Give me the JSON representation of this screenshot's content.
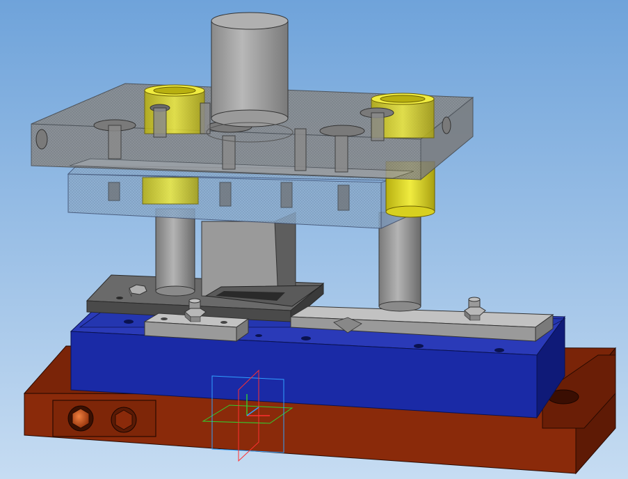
{
  "viewport": {
    "background_top": "#6fa3da",
    "background_bottom": "#c6dcf2"
  },
  "colors": {
    "base_plate": "#8a2a0a",
    "base_plate_dark": "#5a1a05",
    "base_plate_side": "#6e2008",
    "die_block": "#1a2aa6",
    "die_block_top": "#2a3ab8",
    "die_block_side": "#0f1a78",
    "guide_pillar": "#9a9a9a",
    "guide_pillar_shade": "#6e6e6e",
    "punch_holder_transparent": "#8a8a8a",
    "punch_plate_transparent": "#8faac8",
    "bushing_yellow": "#e8e030",
    "shank": "#a8a8a8",
    "stripper_plate": "#6a6a6a",
    "guide_rail": "#b0b0b0",
    "bolt_socket": "#c8501a",
    "axis_x": "#ff3030",
    "axis_y": "#30d030",
    "axis_z": "#30a0ff"
  },
  "icons": {
    "triad": "coordinate-triad-icon",
    "socket_bolt": "hex-socket-bolt-icon",
    "hex_nut": "hex-nut-icon"
  }
}
